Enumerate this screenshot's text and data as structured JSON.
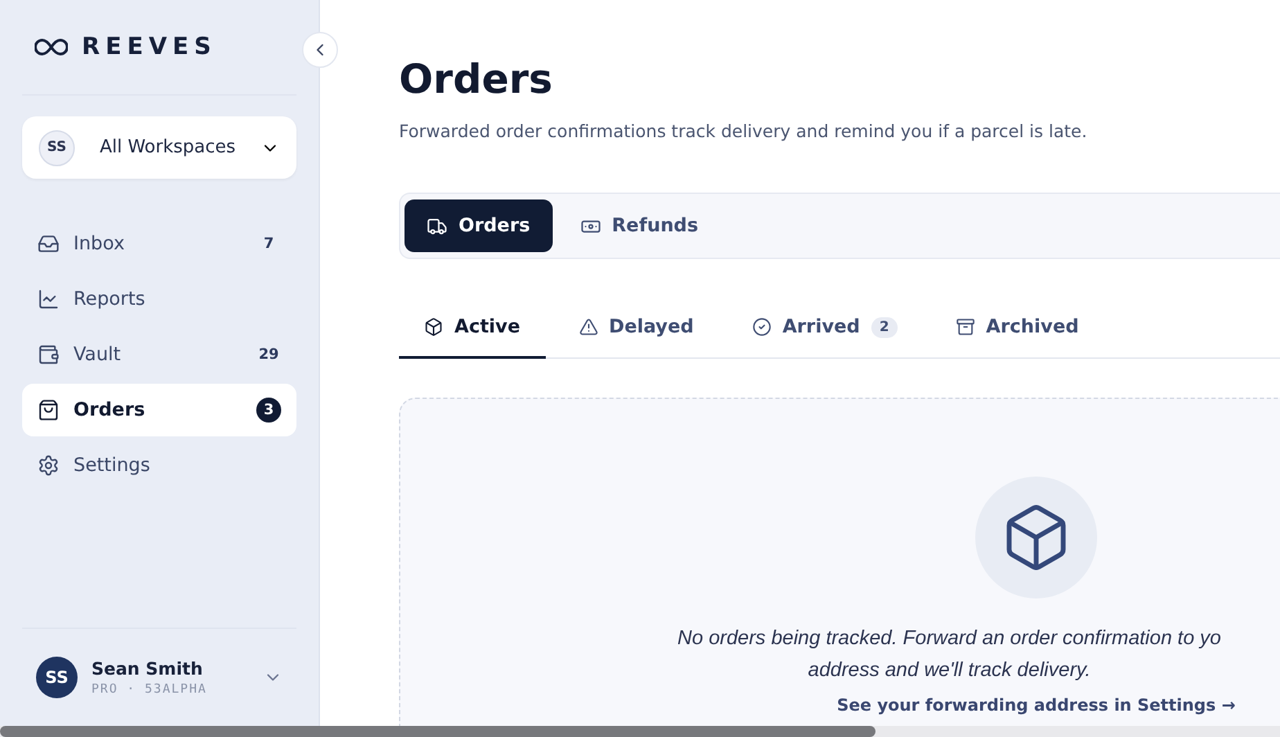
{
  "brand": {
    "name": "REEVES"
  },
  "workspace": {
    "initials": "SS",
    "label": "All Workspaces"
  },
  "nav": [
    {
      "label": "Inbox",
      "count": "7",
      "selected": false
    },
    {
      "label": "Reports",
      "selected": false
    },
    {
      "label": "Vault",
      "count": "29",
      "selected": false
    },
    {
      "label": "Orders",
      "count": "3",
      "selected": true
    },
    {
      "label": "Settings",
      "selected": false
    }
  ],
  "user": {
    "initials": "SS",
    "name": "Sean Smith",
    "meta": "PRO · 53ALPHA"
  },
  "page": {
    "title": "Orders",
    "subtitle": "Forwarded order confirmations track delivery and remind you if a parcel is late."
  },
  "segments": [
    {
      "label": "Orders",
      "selected": true
    },
    {
      "label": "Refunds",
      "selected": false
    }
  ],
  "tabs": [
    {
      "label": "Active",
      "selected": true
    },
    {
      "label": "Delayed",
      "selected": false
    },
    {
      "label": "Arrived",
      "count": "2",
      "selected": false
    },
    {
      "label": "Archived",
      "selected": false
    }
  ],
  "empty_state": {
    "message_lines": [
      "No orders being tracked. Forward an order confirmation to yo",
      "address and we'll track delivery."
    ],
    "link": "See your forwarding address in Settings →"
  }
}
